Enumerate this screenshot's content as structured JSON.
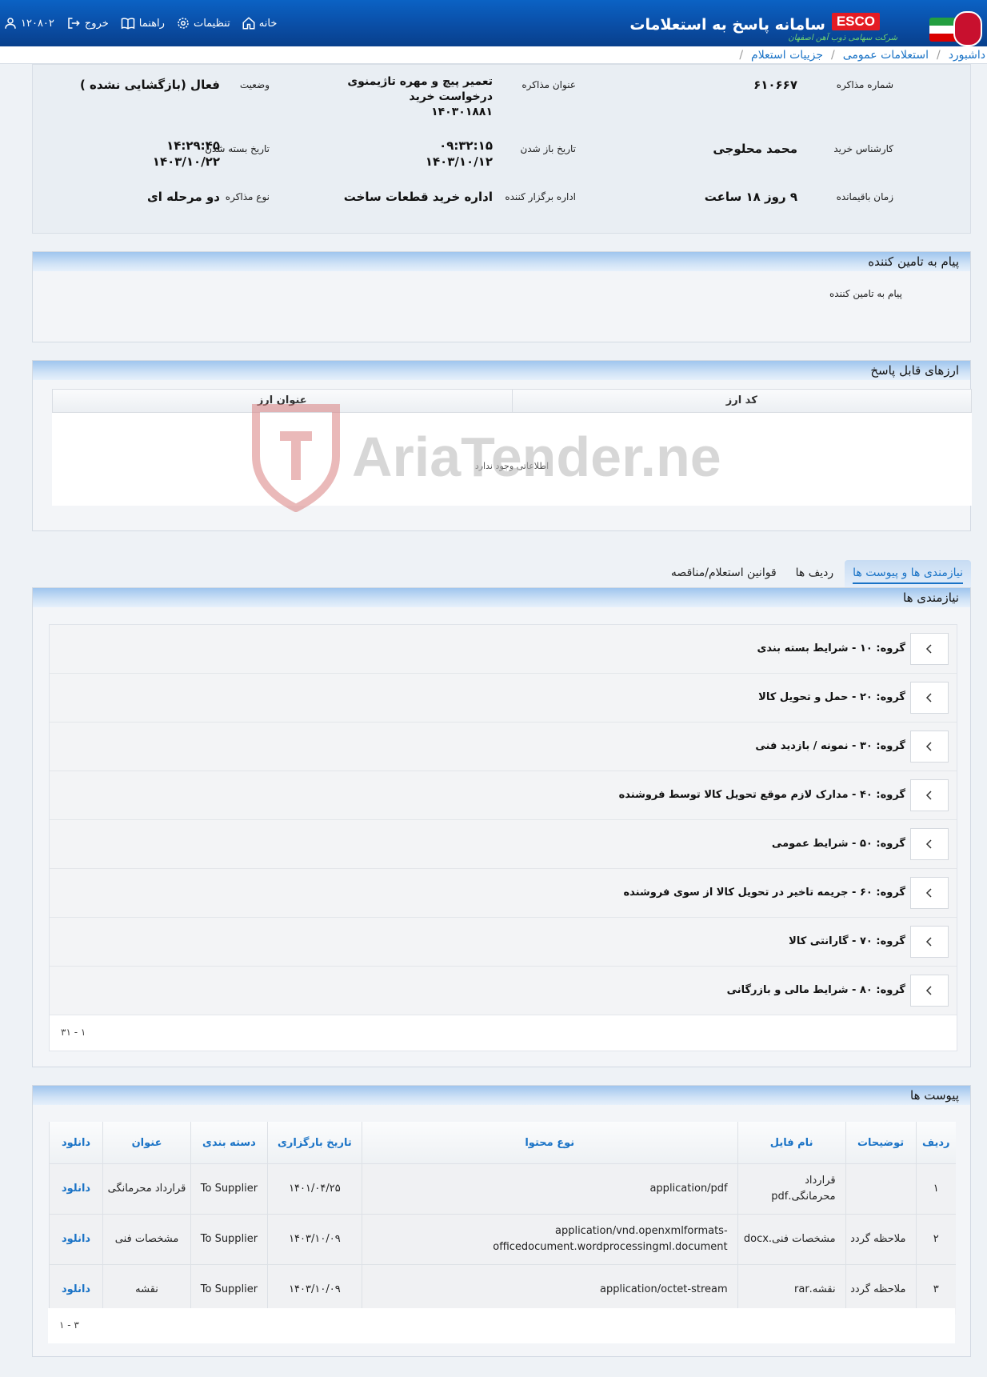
{
  "header": {
    "app_title": "سامانه پاسخ به استعلامات",
    "brand": "ESCO",
    "brand_subtitle": "شرکت سهامی ذوب آهن اصفهان",
    "nav": {
      "home": "خانه",
      "settings": "تنظیمات",
      "guide": "راهنما",
      "logout": "خروج",
      "user_id": "۱۲۰۸۰۲"
    },
    "colors": {
      "bar": "#0a4ea6",
      "brand_red": "#e41b23",
      "link": "#1a73c6"
    }
  },
  "breadcrumb": {
    "items": [
      "داشبورد",
      "استعلامات عمومی",
      "جزییات استعلام"
    ],
    "separator": "/"
  },
  "info": {
    "negotiation_number_label": "شماره مذاکره",
    "negotiation_number": "۶۱۰۶۶۷",
    "negotiation_title_label": "عنوان مذاکره",
    "negotiation_title_line1": "تعمیر پیچ و مهره تاژیمنوی",
    "negotiation_title_line2": "درخواست خرید",
    "negotiation_title_line3": "۱۴۰۳۰۱۸۸۱",
    "status_label": "وضعیت",
    "status": "فعال (بازگشایی نشده )",
    "buyer_expert_label": "کارشناس خرید",
    "buyer_expert": "محمد محلوجی",
    "opening_date_label": "تاریخ باز شدن",
    "opening_time": "۰۹:۳۲:۱۵",
    "opening_date": "۱۴۰۳/۱۰/۱۲",
    "closing_date_label": "تاریخ بسته شدن",
    "closing_time": "۱۴:۲۹:۴۵",
    "closing_date": "۱۴۰۳/۱۰/۲۲",
    "remaining_time_label": "زمان باقیمانده",
    "remaining_time": "۹ روز ۱۸ ساعت",
    "organizer_label": "اداره برگزار کننده",
    "organizer": "اداره خرید قطعات ساخت",
    "negotiation_type_label": "نوع مذاکره",
    "negotiation_type": "دو مرحله ای"
  },
  "supplier_message": {
    "title": "پیام به تامین کننده",
    "body": "پیام به تامین کننده"
  },
  "currencies": {
    "title": "ارزهای قابل پاسخ",
    "columns": [
      "کد ارز",
      "عنوان ارز"
    ],
    "empty_text": "اطلاعاتی وجود ندارد",
    "watermark": "AriaTender.neT"
  },
  "tabs": [
    {
      "label": "نیازمندی ها و پیوست ها",
      "active": true
    },
    {
      "label": "ردیف ها",
      "active": false
    },
    {
      "label": "قوانین استعلام/مناقصه",
      "active": false
    }
  ],
  "requirements": {
    "title": "نیازمندی ها",
    "groups": [
      "گروه: ۱۰ - شرایط بسته بندی",
      "گروه: ۲۰ - حمل و تحویل کالا",
      "گروه: ۳۰ - نمونه / بازدید فنی",
      "گروه: ۴۰ - مدارک لازم موقع تحویل کالا توسط فروشنده",
      "گروه: ۵۰ - شرایط عمومی",
      "گروه: ۶۰ - جریمه تاخیر در تحویل کالا از سوی فروشنده",
      "گروه: ۷۰ - گارانتی کالا",
      "گروه: ۸۰ - شرایط مالی و بازرگانی"
    ],
    "pager": "۱ - ۳۱"
  },
  "attachments": {
    "title": "پیوست ها",
    "columns": [
      "ردیف",
      "توضیحات",
      "نام فایل",
      "نوع محتوا",
      "تاریخ بارگزاری",
      "دسته بندی",
      "عنوان",
      "دانلود"
    ],
    "rows": [
      {
        "row": "۱",
        "desc": "",
        "file": "قرارداد محرمانگی.pdf",
        "content_type": "application/pdf",
        "date": "۱۴۰۱/۰۴/۲۵",
        "category": "To Supplier",
        "title": "قرارداد محرمانگی",
        "download": "دانلود"
      },
      {
        "row": "۲",
        "desc": "ملاحظه گردد",
        "file": "مشخصات فنی.docx",
        "content_type": "application/vnd.openxmlformats-officedocument.wordprocessingml.document",
        "date": "۱۴۰۳/۱۰/۰۹",
        "category": "To Supplier",
        "title": "مشخصات فنی",
        "download": "دانلود"
      },
      {
        "row": "۳",
        "desc": "ملاحظه گردد",
        "file": "نقشه.rar",
        "content_type": "application/octet-stream",
        "date": "۱۴۰۳/۱۰/۰۹",
        "category": "To Supplier",
        "title": "نقشه",
        "download": "دانلود"
      }
    ],
    "pager": "۱ - ۳"
  }
}
